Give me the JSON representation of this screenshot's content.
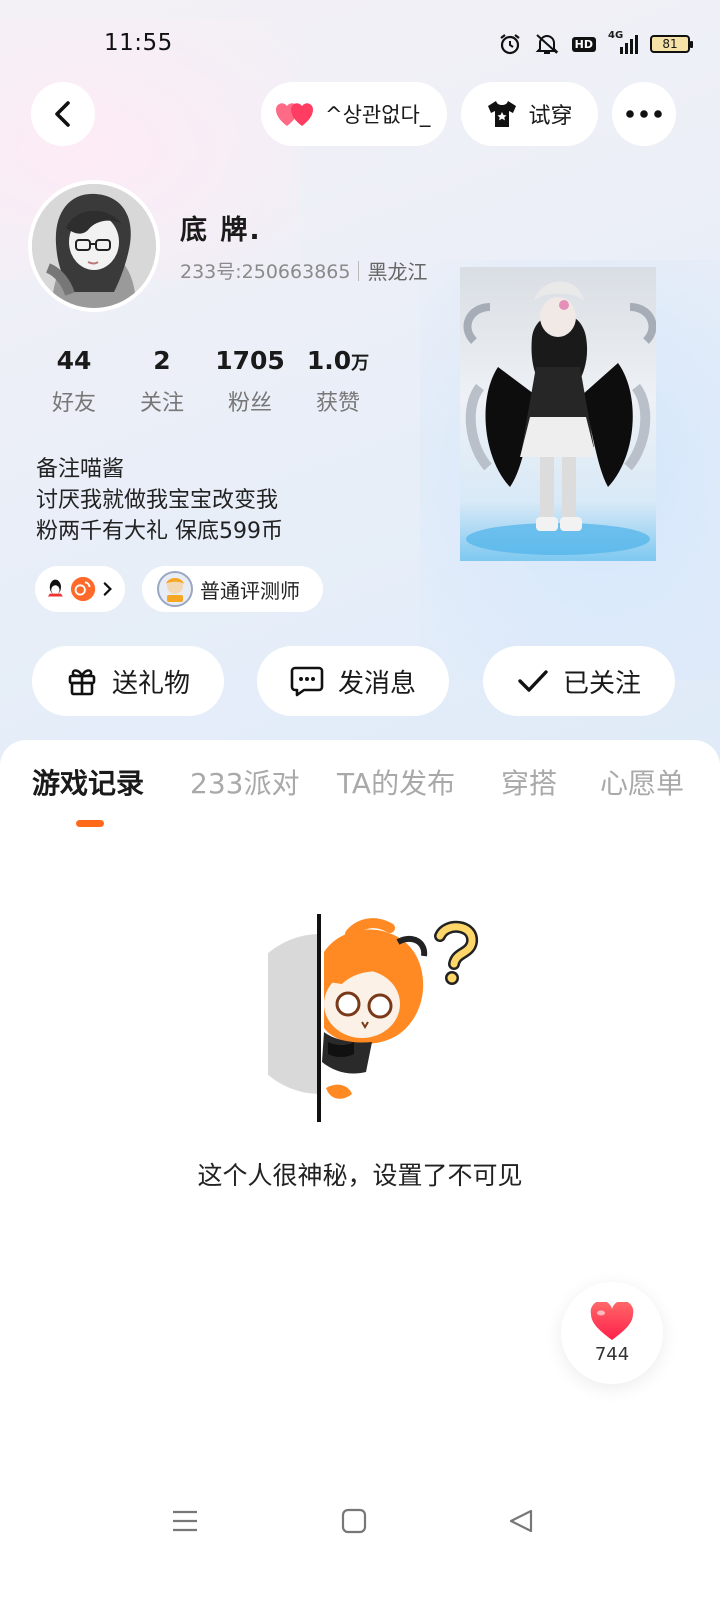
{
  "status_bar": {
    "time": "11:55",
    "network": "4G",
    "battery": "81",
    "hd_badge": "HD",
    "icons": [
      "alarm-icon",
      "mute-icon",
      "hd-icon",
      "signal-icon",
      "battery-icon"
    ]
  },
  "top_nav": {
    "back_icon": "chevron-left-icon",
    "couple_label": "^상관없다_",
    "couple_icon": "double-heart-icon",
    "try_on_label": "试穿",
    "try_on_icon": "tshirt-icon",
    "more_icon": "more-dots-icon"
  },
  "profile": {
    "username": "底 牌.",
    "user_id": "233号:250663865",
    "region": "黑龙江"
  },
  "stats": [
    {
      "value": "44",
      "unit": "",
      "label": "好友"
    },
    {
      "value": "2",
      "unit": "",
      "label": "关注"
    },
    {
      "value": "1705",
      "unit": "",
      "label": "粉丝"
    },
    {
      "value": "1.0",
      "unit": "万",
      "label": "获赞"
    }
  ],
  "bio": {
    "line1": "备注喵酱",
    "line2": "讨厌我就做我宝宝改变我",
    "line3": "粉两千有大礼 保底599币"
  },
  "chips": {
    "social_icons": [
      "qq-icon",
      "weibo-icon"
    ],
    "badge_label": "普通评测师"
  },
  "actions": {
    "gift": "送礼物",
    "message": "发消息",
    "followed": "已关注"
  },
  "tabs": [
    "游戏记录",
    "233派对",
    "TA的发布",
    "穿搭",
    "心愿单"
  ],
  "active_tab": "游戏记录",
  "empty_state": {
    "message": "这个人很神秘，设置了不可见"
  },
  "like_fab": {
    "count": "744"
  },
  "colors": {
    "accent_orange": "#ff6a1a",
    "heart_red": "#ff3d52",
    "text_primary": "#1a1a1a",
    "text_secondary": "#8a8a8a"
  }
}
